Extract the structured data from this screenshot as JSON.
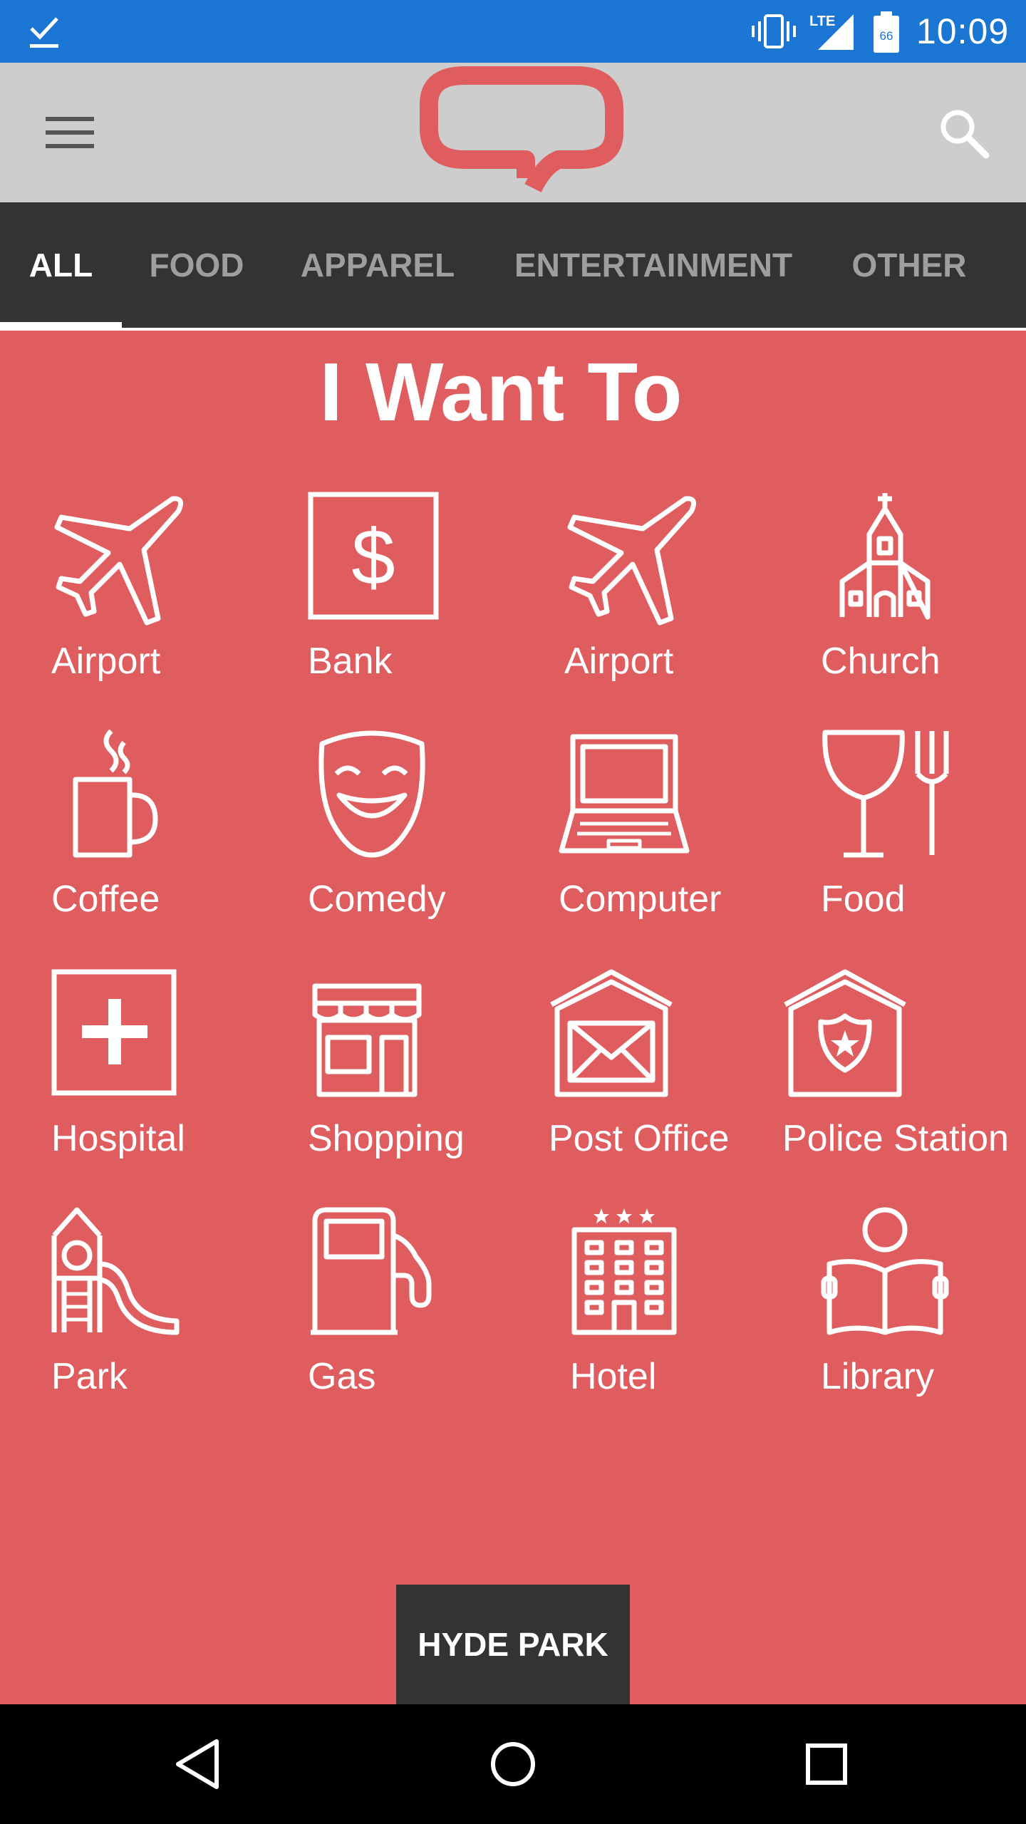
{
  "status_bar": {
    "time": "10:09",
    "network_label": "LTE",
    "battery_level": "66",
    "icons": [
      "check-icon",
      "vibrate-icon",
      "signal-icon",
      "battery-icon"
    ]
  },
  "app_bar": {
    "icons": [
      "menu-icon",
      "app-logo",
      "search-icon"
    ],
    "brand_color": "#e05d5f"
  },
  "tabs": [
    {
      "label": "ALL",
      "active": true
    },
    {
      "label": "FOOD",
      "active": false
    },
    {
      "label": "APPAREL",
      "active": false
    },
    {
      "label": "ENTERTAINMENT",
      "active": false
    },
    {
      "label": "OTHER",
      "active": false
    }
  ],
  "main": {
    "heading": "I Want To",
    "categories": [
      {
        "label": "Airport",
        "icon": "airplane-icon"
      },
      {
        "label": "Bank",
        "icon": "bank-icon"
      },
      {
        "label": "Airport",
        "icon": "airplane-icon"
      },
      {
        "label": "Church",
        "icon": "church-icon"
      },
      {
        "label": "Coffee",
        "icon": "coffee-icon"
      },
      {
        "label": "Comedy",
        "icon": "comedy-mask-icon"
      },
      {
        "label": "Computer",
        "icon": "laptop-icon"
      },
      {
        "label": "Food",
        "icon": "food-icon"
      },
      {
        "label": "Hospital",
        "icon": "hospital-icon"
      },
      {
        "label": "Shopping",
        "icon": "shop-icon"
      },
      {
        "label": "Post Office",
        "icon": "post-office-icon"
      },
      {
        "label": "Police Station",
        "icon": "police-station-icon"
      },
      {
        "label": "Park",
        "icon": "playground-icon"
      },
      {
        "label": "Gas",
        "icon": "gas-pump-icon"
      },
      {
        "label": "Hotel",
        "icon": "hotel-icon"
      },
      {
        "label": "Library",
        "icon": "library-reader-icon"
      }
    ]
  },
  "location": {
    "label": "HYDE PARK"
  },
  "nav_bar": {
    "icons": [
      "back-icon",
      "home-icon",
      "recents-icon"
    ]
  },
  "colors": {
    "status_bar": "#1a76d2",
    "app_bar": "#cdcdcd",
    "tab_bar": "#333333",
    "background": "#e05d5f",
    "nav_bar": "#000000"
  }
}
